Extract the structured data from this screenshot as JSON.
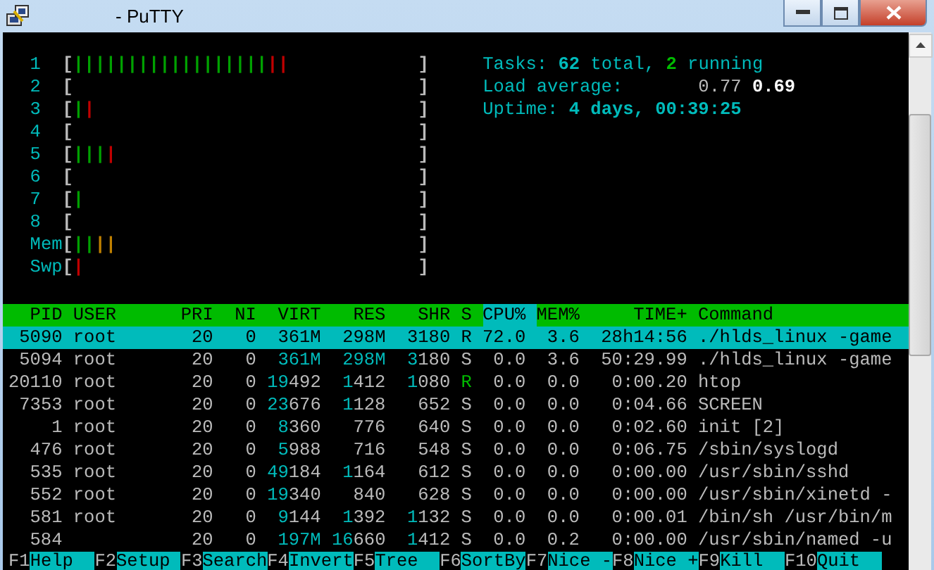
{
  "window": {
    "title": "- PuTTY"
  },
  "meters": [
    {
      "label": "1",
      "open": "[",
      "close": "]",
      "segments": [
        {
          "text": "||||||||||||||||||",
          "color": "#00a000"
        },
        {
          "text": "|",
          "color": "#c00000"
        },
        {
          "text": "|",
          "color": "#c00000"
        }
      ]
    },
    {
      "label": "2",
      "open": "[",
      "close": "]"
    },
    {
      "label": "3",
      "open": "[",
      "close": "]",
      "segments": [
        {
          "text": "|",
          "color": "#00a000"
        },
        {
          "text": "|",
          "color": "#c00000"
        }
      ]
    },
    {
      "label": "4",
      "open": "[",
      "close": "]"
    },
    {
      "label": "5",
      "open": "[",
      "close": "]",
      "segments": [
        {
          "text": "|",
          "color": "#00a000"
        },
        {
          "text": "|",
          "color": "#00a000"
        },
        {
          "text": "|",
          "color": "#00a000"
        },
        {
          "text": "|",
          "color": "#c00000"
        }
      ]
    },
    {
      "label": "6",
      "open": "[",
      "close": "]"
    },
    {
      "label": "7",
      "open": "[",
      "close": "]",
      "segments": [
        {
          "text": "|",
          "color": "#00a000"
        }
      ]
    },
    {
      "label": "8",
      "open": "[",
      "close": "]"
    },
    {
      "label": "Mem",
      "open": "[",
      "close": "]",
      "segments": [
        {
          "text": "|",
          "color": "#00a000"
        },
        {
          "text": "|",
          "color": "#00a000"
        },
        {
          "text": "|",
          "color": "#c08000"
        },
        {
          "text": "|",
          "color": "#c08000"
        }
      ]
    },
    {
      "label": "Swp",
      "open": "[",
      "close": "]",
      "segments": [
        {
          "text": "|",
          "color": "#c00000"
        }
      ]
    }
  ],
  "info": [
    [
      {
        "text": "Tasks: ",
        "kind": "label"
      },
      {
        "text": "62",
        "kind": "value"
      },
      {
        "text": " total, ",
        "kind": "label"
      },
      {
        "text": "2",
        "kind": "running"
      },
      {
        "text": " running",
        "kind": "label"
      }
    ],
    [
      {
        "text": "Load average:       ",
        "kind": "label"
      },
      {
        "text": "0.77 ",
        "kind": "dim"
      },
      {
        "text": "0.69",
        "kind": "bright"
      }
    ],
    [
      {
        "text": "Uptime: ",
        "kind": "label"
      },
      {
        "text": "4 days, 00:39:25",
        "kind": "value"
      }
    ]
  ],
  "table": {
    "columns": [
      {
        "label": "PID",
        "selected": false
      },
      {
        "label": "USER",
        "selected": false
      },
      {
        "label": "PRI",
        "selected": false
      },
      {
        "label": "NI",
        "selected": false
      },
      {
        "label": "VIRT",
        "selected": false
      },
      {
        "label": "RES",
        "selected": false
      },
      {
        "label": "SHR",
        "selected": false
      },
      {
        "label": "S",
        "selected": false
      },
      {
        "label": "CPU%",
        "selected": true
      },
      {
        "label": "MEM%",
        "selected": false
      },
      {
        "label": "TIME+",
        "selected": false
      },
      {
        "label": "Command",
        "selected": false
      }
    ],
    "rows": [
      {
        "selected": true,
        "cells": [
          "5090",
          "root",
          "20",
          "0",
          "361M",
          "298M",
          "3180",
          "R",
          "72.0",
          "3.6",
          "28h14:56",
          "./hlds_linux -game"
        ]
      },
      {
        "selected": false,
        "cells": [
          "5094",
          "root",
          "20",
          "0",
          "361M",
          "298M",
          "3180",
          "S",
          "0.0",
          "3.6",
          "50:29.99",
          "./hlds_linux -game"
        ]
      },
      {
        "selected": false,
        "cells": [
          "20110",
          "root",
          "20",
          "0",
          "19492",
          "1412",
          "1080",
          "R",
          "0.0",
          "0.0",
          "0:00.20",
          "htop"
        ]
      },
      {
        "selected": false,
        "cells": [
          "7353",
          "root",
          "20",
          "0",
          "23676",
          "1128",
          "652",
          "S",
          "0.0",
          "0.0",
          "0:04.66",
          "SCREEN"
        ]
      },
      {
        "selected": false,
        "cells": [
          "1",
          "root",
          "20",
          "0",
          "8360",
          "776",
          "640",
          "S",
          "0.0",
          "0.0",
          "0:02.60",
          "init [2]"
        ]
      },
      {
        "selected": false,
        "cells": [
          "476",
          "root",
          "20",
          "0",
          "5988",
          "716",
          "548",
          "S",
          "0.0",
          "0.0",
          "0:06.75",
          "/sbin/syslogd"
        ]
      },
      {
        "selected": false,
        "cells": [
          "535",
          "root",
          "20",
          "0",
          "49184",
          "1164",
          "612",
          "S",
          "0.0",
          "0.0",
          "0:00.00",
          "/usr/sbin/sshd"
        ]
      },
      {
        "selected": false,
        "cells": [
          "552",
          "root",
          "20",
          "0",
          "19340",
          "840",
          "628",
          "S",
          "0.0",
          "0.0",
          "0:00.00",
          "/usr/sbin/xinetd -"
        ]
      },
      {
        "selected": false,
        "cells": [
          "581",
          "root",
          "20",
          "0",
          "9144",
          "1392",
          "1132",
          "S",
          "0.0",
          "0.0",
          "0:00.01",
          "/bin/sh /usr/bin/m"
        ]
      },
      {
        "selected": false,
        "cells": [
          "584",
          null,
          "20",
          "0",
          "197M",
          "16660",
          "1412",
          "S",
          "0.0",
          "0.2",
          "0:00.00",
          "/usr/sbin/named -u"
        ]
      }
    ]
  },
  "function_keys": [
    {
      "key": "F1",
      "label": "Help"
    },
    {
      "key": "F2",
      "label": "Setup"
    },
    {
      "key": "F3",
      "label": "Search"
    },
    {
      "key": "F4",
      "label": "Invert"
    },
    {
      "key": "F5",
      "label": "Tree"
    },
    {
      "key": "F6",
      "label": "SortBy"
    },
    {
      "key": "F7",
      "label": "Nice -"
    },
    {
      "key": "F8",
      "label": "Nice +"
    },
    {
      "key": "F9",
      "label": "Kill"
    },
    {
      "key": "F10",
      "label": "Quit"
    }
  ]
}
